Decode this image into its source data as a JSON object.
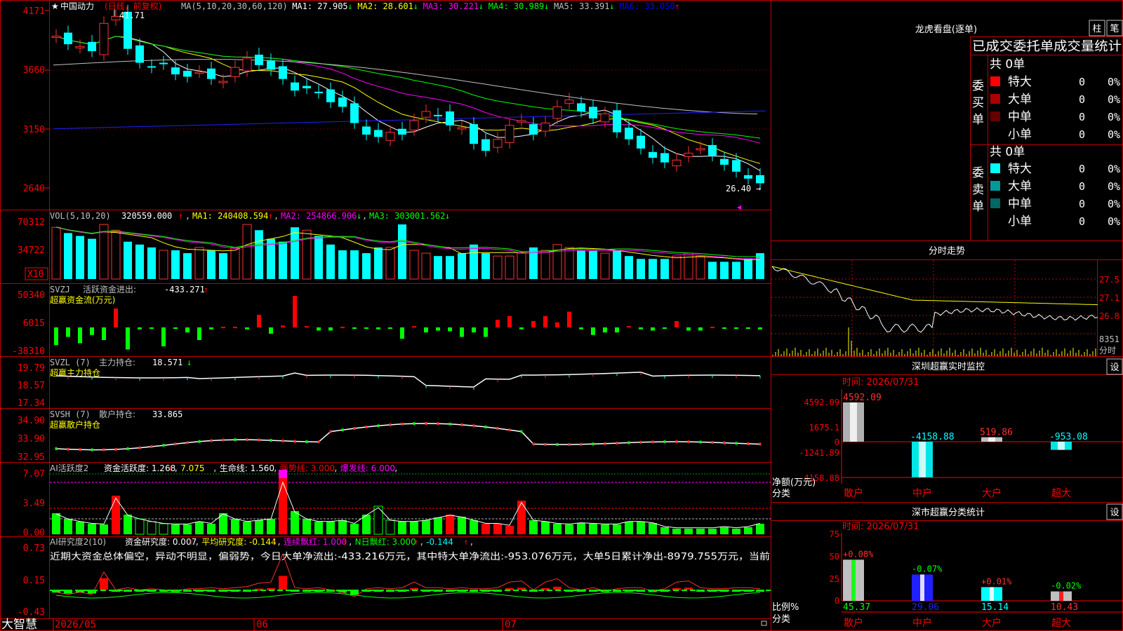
{
  "app": {
    "brand": "大智慧"
  },
  "main_chart": {
    "stock_name": "中国动力",
    "period": "(日线，前复权)",
    "ma_params": "MA(5,10,20,30,60,120)",
    "ma": [
      {
        "label": "MA1:",
        "value": "27.905",
        "dir": "↓",
        "color": "#ffffff"
      },
      {
        "label": "MA2:",
        "value": "28.601",
        "dir": "↓",
        "color": "#ffff00"
      },
      {
        "label": "MA3:",
        "value": "30.221",
        "dir": "↓",
        "color": "#ff00ff"
      },
      {
        "label": "MA4:",
        "value": "30.989",
        "dir": "↓",
        "color": "#00ff00"
      },
      {
        "label": "MA5:",
        "value": "33.391",
        "dir": "↓",
        "color": "#c0c0c0"
      },
      {
        "label": "MA6:",
        "value": "33.050",
        "dir": "↑",
        "color": "#0000ff"
      }
    ],
    "price_ticks": [
      "41.71",
      "36.60",
      "31.50",
      "26.40"
    ],
    "axis_labels": [
      "4171",
      "3660",
      "3150",
      "2640"
    ],
    "high_label": "41.71",
    "low_label": "26.40",
    "dates": [
      "2026/05",
      "06",
      "07"
    ]
  },
  "volume": {
    "title": "VOL(5,10,20)",
    "value": "320559.000",
    "ma": [
      {
        "label": "MA1:",
        "value": "240408.594",
        "dir": "↑",
        "color": "#ffff00"
      },
      {
        "label": "MA2:",
        "value": "254866.906",
        "dir": "↓",
        "color": "#ff00ff"
      },
      {
        "label": "MA3:",
        "value": "303001.562",
        "dir": "↓",
        "color": "#00ff00"
      }
    ],
    "axis": [
      "70312",
      "34722"
    ],
    "unit": "X10"
  },
  "svzj": {
    "title": "SVZJ",
    "name": "活跃资金进出:",
    "value": "-433.271",
    "dir": "↑",
    "subtitle": "超赢资金流(万元)",
    "axis": [
      "50340",
      "6015",
      "-38310"
    ]
  },
  "svzl": {
    "title": "SVZL (7)",
    "name": "主力持仓:",
    "value": "18.571",
    "dir": "↓",
    "subtitle": "超赢主力持仓",
    "axis": [
      "19.79",
      "18.57",
      "17.34"
    ]
  },
  "svsh": {
    "title": "SVSH (7)",
    "name": "散户持仓:",
    "value": "33.865",
    "dir": "",
    "subtitle": "超赢散户持仓",
    "axis": [
      "34.90",
      "33.90",
      "32.95"
    ]
  },
  "ai_active": {
    "title": "AI活跃度2",
    "items": [
      {
        "label": "资金活跃度:",
        "value": "1.268",
        "dir": "↑",
        "color": "#ffffff"
      },
      {
        "label": "",
        "value": "7.075",
        "dir": "",
        "color": "#ffff00"
      },
      {
        "label": "生命线:",
        "value": "1.560",
        "dir": "",
        "color": "#ffffff"
      },
      {
        "label": "强势线:",
        "value": "3.000",
        "dir": "",
        "color": "#ff0000"
      },
      {
        "label": "爆发线:",
        "value": "6.000",
        "dir": "",
        "color": "#ff00ff"
      }
    ],
    "axis": [
      "7.07",
      "3.49",
      "0.00"
    ]
  },
  "ai_research": {
    "title": "AI研究度2(10)",
    "items": [
      {
        "label": "资金研究度:",
        "value": "0.007",
        "dir": "↑",
        "color": "#ffffff"
      },
      {
        "label": "平均研究度:",
        "value": "-0.144",
        "dir": "↑",
        "color": "#ffff00"
      },
      {
        "label": "连续飘红:",
        "value": "1.000",
        "dir": "↑",
        "color": "#ff00ff"
      },
      {
        "label": "N日飘红:",
        "value": "3.000",
        "dir": "↑",
        "color": "#00ff00"
      },
      {
        "label": "",
        "value": "-0.144",
        "dir": "↑",
        "color": "#00ffff"
      }
    ],
    "note": "近期大资金总体偏空，异动不明显，偏弱势，今日大单净流出:-433.216万元，其中特大单净流出:-953.076万元，大单5日累计净出-8979.755万元，当前",
    "axis": [
      "0.73",
      "0.15",
      "-0.43"
    ]
  },
  "dragon": {
    "title": "龙虎看盘(逐单)",
    "tab1": "柱",
    "tab2": "笔",
    "header": "已成交委托单成交量统计",
    "buy_label": "委买单",
    "sell_label": "委卖单",
    "buy_total": "共 0单",
    "sell_total": "共 0单",
    "buy_rows": [
      {
        "name": "特大",
        "val": "0",
        "pct": "0%",
        "color": "#ff0000"
      },
      {
        "name": "大单",
        "val": "0",
        "pct": "0%",
        "color": "#aa0000"
      },
      {
        "name": "中单",
        "val": "0",
        "pct": "0%",
        "color": "#660000"
      },
      {
        "name": "小单",
        "val": "0",
        "pct": "0%",
        "color": ""
      }
    ],
    "sell_rows": [
      {
        "name": "特大",
        "val": "0",
        "pct": "0%",
        "color": "#00ffff"
      },
      {
        "name": "大单",
        "val": "0",
        "pct": "0%",
        "color": "#009999"
      },
      {
        "name": "中单",
        "val": "0",
        "pct": "0%",
        "color": "#006666"
      },
      {
        "name": "小单",
        "val": "0",
        "pct": "0%",
        "color": ""
      }
    ]
  },
  "intraday": {
    "title": "分时走势",
    "axis": [
      "27.5",
      "27.1",
      "26.8"
    ],
    "vol": "8351",
    "vol_unit": "分时"
  },
  "monitor": {
    "title": "深圳超赢实时监控",
    "settings": "设",
    "time": "时间: 2026/07/31",
    "axis": [
      "4592.09",
      "1675.1",
      "0",
      "-1241.89",
      "-4158.88"
    ],
    "ylabel": "净额(万元)",
    "xlabel": "分类",
    "cats": [
      "散户",
      "中户",
      "大户",
      "超大"
    ],
    "values": [
      "4592.09",
      "-4158.88",
      "519.86",
      "-953.08"
    ],
    "nums": [
      4592.09,
      -4158.88,
      519.86,
      -953.08
    ]
  },
  "classstat": {
    "title": "深市超赢分类统计",
    "settings": "设",
    "time": "时间: 2026/07/31",
    "axis": [
      "75",
      "50",
      "25",
      "0"
    ],
    "ylabel": "比例%",
    "xlabel": "分类",
    "cats": [
      "散户",
      "中户",
      "大户",
      "超大"
    ],
    "values": [
      "45.37",
      "29.06",
      "15.14",
      "10.43"
    ],
    "changes": [
      "+0.08%",
      "-0.07%",
      "+0.01%",
      "-0.02%"
    ],
    "nums": [
      45.37,
      29.06,
      15.14,
      10.43
    ]
  }
}
